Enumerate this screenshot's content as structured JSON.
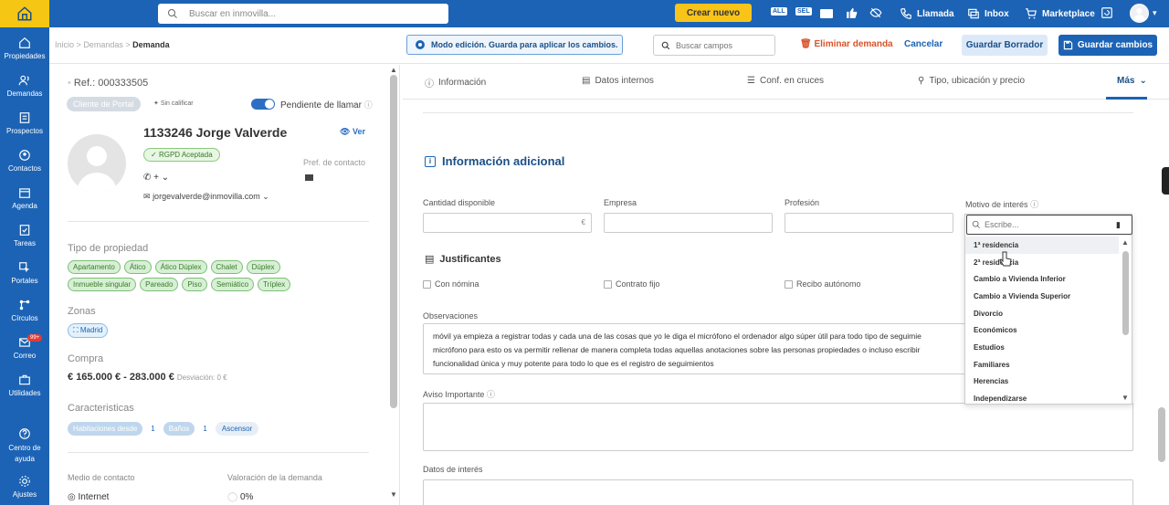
{
  "top": {
    "search_placeholder": "Buscar en inmovilla...",
    "crear": "Crear nuevo",
    "icon_all": "ALL",
    "icon_sel": "SEL",
    "llamada": "Llamada",
    "inbox": "Inbox",
    "marketplace": "Marketplace"
  },
  "sidebar": [
    {
      "label": "Propiedades",
      "icon": "home-icon"
    },
    {
      "label": "Demandas",
      "icon": "people-icon"
    },
    {
      "label": "Prospectos",
      "icon": "list-icon"
    },
    {
      "label": "Contactos",
      "icon": "contact-icon"
    },
    {
      "label": "Agenda",
      "icon": "calendar-icon"
    },
    {
      "label": "Tareas",
      "icon": "checklist-icon"
    },
    {
      "label": "Portales",
      "icon": "cursor-icon"
    },
    {
      "label": "Círculos",
      "icon": "nodes-icon"
    },
    {
      "label": "Correo",
      "icon": "mail-icon",
      "badge": "99+"
    },
    {
      "label": "Utilidades",
      "icon": "toolbox-icon"
    },
    {
      "label": "Centro de ayuda",
      "icon": "help-icon"
    },
    {
      "label": "Ajustes",
      "icon": "gear-icon"
    }
  ],
  "breadcrumb": {
    "home": "Inicio",
    "sep": ">",
    "parent": "Demandas",
    "current": "Demanda"
  },
  "edit_mode": "Modo edición. Guarda para aplicar los cambios.",
  "search_fields_placeholder": "Buscar campos",
  "actions": {
    "eliminar": "Eliminar demanda",
    "cancelar": "Cancelar",
    "borrador": "Guardar Borrador",
    "guardar": "Guardar cambios"
  },
  "left": {
    "ref": "Ref.: 000333505",
    "tag": "Cliente de Portal",
    "sin_calificar": "Sin calificar",
    "pendiente": "Pendiente de llamar",
    "name": "1133246 Jorge Valverde",
    "ver": "Ver",
    "rgpd": "RGPD Aceptada",
    "pref": "Pref. de contacto",
    "phone": "+",
    "email": "jorgevalverde@inmovilla.com",
    "tipo_label": "Tipo de propiedad",
    "tipos": [
      "Apartamento",
      "Ático",
      "Ático Dúplex",
      "Chalet",
      "Dúplex",
      "Inmueble singular",
      "Pareado",
      "Piso",
      "Semiático",
      "Tríplex"
    ],
    "zonas_label": "Zonas",
    "zona": "Madrid",
    "compra_label": "Compra",
    "compra": "165.000 € - 283.000 €",
    "desviacion": "Desviación: 0 €",
    "carac_label": "Caracteristicas",
    "hab": "Habitaciones desde",
    "hab_n": "1",
    "banos": "Baños",
    "banos_n": "1",
    "ascensor": "Ascensor",
    "medio_label": "Medio de contacto",
    "medio": "Internet",
    "valor_label": "Valoración de la demanda",
    "valor": "0%"
  },
  "tabs": [
    {
      "label": "Información",
      "icon": "info-icon"
    },
    {
      "label": "Datos internos",
      "icon": "document-icon"
    },
    {
      "label": "Conf. en cruces",
      "icon": "sliders-icon"
    },
    {
      "label": "Tipo, ubicación y precio",
      "icon": "map-pin-icon"
    },
    {
      "label": "Más",
      "icon": "chevron-down-icon"
    }
  ],
  "info": {
    "title": "Información adicional",
    "cantidad": "Cantidad disponible",
    "euro": "€",
    "empresa": "Empresa",
    "profesion": "Profesión",
    "motivo": "Motivo de interés",
    "justificantes": "Justificantes",
    "chk1": "Con nómina",
    "chk2": "Contrato fijo",
    "chk3": "Recibo autónomo",
    "observaciones": "Observaciones",
    "obs_lines": [
      "móvil ya empieza a registrar todas y cada una de las cosas que yo le diga el micrófono el ordenador algo súper útil para todo tipo de seguimie",
      "micrófono para esto os va permitir rellenar de manera completa todas aquellas anotaciones sobre las personas propiedades o incluso escribir",
      "funcionalidad única y muy potente para todo lo que es el registro de seguimientos"
    ],
    "aviso": "Aviso Importante",
    "datos": "Datos de interés"
  },
  "dropdown": {
    "placeholder": "Escribe...",
    "items": [
      "1ª residencia",
      "2ª residencia",
      "Cambio a Vivienda Inferior",
      "Cambio a Vivienda Superior",
      "Divorcio",
      "Económicos",
      "Estudios",
      "Familiares",
      "Herencias",
      "Independizarse"
    ]
  }
}
